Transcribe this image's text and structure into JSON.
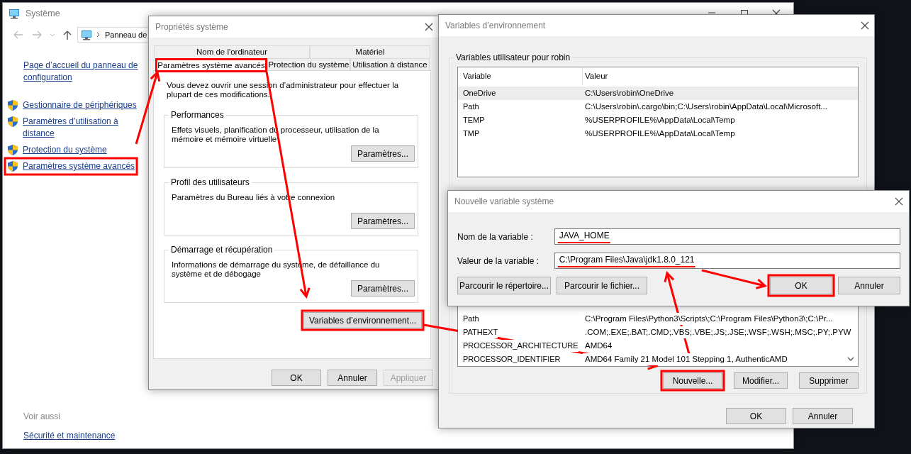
{
  "system_window": {
    "title": "Système",
    "address": "Panneau de",
    "sidebar": {
      "home_link": "Page d’accueil du panneau de configuration",
      "items": [
        {
          "label": "Gestionnaire de périphériques",
          "highlighted": false
        },
        {
          "label": "Paramètres d’utilisation à distance",
          "highlighted": false
        },
        {
          "label": "Protection du système",
          "highlighted": false
        },
        {
          "label": "Paramètres système avancés",
          "highlighted": true
        }
      ]
    },
    "see_also": {
      "heading": "Voir aussi",
      "links": [
        "Sécurité et maintenance"
      ]
    }
  },
  "system_properties": {
    "title": "Propriétés système",
    "tab_rows": [
      [
        {
          "label": "Nom de l'ordinateur",
          "selected": false
        },
        {
          "label": "Matériel",
          "selected": false
        }
      ],
      [
        {
          "label": "Paramètres système avancés",
          "selected": true,
          "highlighted": true
        },
        {
          "label": "Protection du système",
          "selected": false,
          "highlighted": false
        },
        {
          "label": "Utilisation à distance",
          "selected": false,
          "highlighted": false
        }
      ]
    ],
    "notice": "Vous devez ouvrir une session d’administrateur pour effectuer la plupart de ces modifications.",
    "groups": [
      {
        "title": "Performances",
        "description": "Effets visuels, planification du processeur, utilisation de la mémoire et mémoire virtuelle",
        "button": "Paramètres..."
      },
      {
        "title": "Profil des utilisateurs",
        "description": "Paramètres du Bureau liés à votre connexion",
        "button": "Paramètres..."
      },
      {
        "title": "Démarrage et récupération",
        "description": "Informations de démarrage du système, de défaillance du système et de débogage",
        "button": "Paramètres..."
      }
    ],
    "env_button": {
      "label": "Variables d’environnement...",
      "highlighted": true
    },
    "buttons": [
      {
        "label": "OK",
        "disabled": false
      },
      {
        "label": "Annuler",
        "disabled": false
      },
      {
        "label": "Appliquer",
        "disabled": true
      }
    ]
  },
  "environment_variables": {
    "title": "Variables d’environnement",
    "user_group": {
      "title": "Variables utilisateur pour robin",
      "columns": [
        "Variable",
        "Valeur"
      ],
      "rows": [
        {
          "variable": "OneDrive",
          "value": "C:\\Users\\robin\\OneDrive",
          "selected": true
        },
        {
          "variable": "Path",
          "value": "C:\\Users\\robin\\.cargo\\bin;C:\\Users\\robin\\AppData\\Local\\Microsoft...",
          "selected": false
        },
        {
          "variable": "TEMP",
          "value": "%USERPROFILE%\\AppData\\Local\\Temp",
          "selected": false
        },
        {
          "variable": "TMP",
          "value": "%USERPROFILE%\\AppData\\Local\\Temp",
          "selected": false
        }
      ]
    },
    "system_rows": [
      {
        "variable": "Path",
        "value": "C:\\Program Files\\Python3\\Scripts\\;C:\\Program Files\\Python3\\;C:\\Pr...",
        "selected": false
      },
      {
        "variable": "PATHEXT",
        "value": ".COM;.EXE;.BAT;.CMD;.VBS;.VBE;.JS;.JSE;.WSF;.WSH;.MSC;.PY;.PYW",
        "selected": false
      },
      {
        "variable": "PROCESSOR_ARCHITECTURE",
        "value": "AMD64",
        "selected": false
      },
      {
        "variable": "PROCESSOR_IDENTIFIER",
        "value": "AMD64 Family 21 Model 101 Stepping 1, AuthenticAMD",
        "selected": false
      }
    ],
    "system_buttons": [
      {
        "label": "Nouvelle...",
        "highlighted": true
      },
      {
        "label": "Modifier...",
        "highlighted": false
      },
      {
        "label": "Supprimer",
        "highlighted": false
      }
    ],
    "buttons": [
      "OK",
      "Annuler"
    ]
  },
  "new_variable_dialog": {
    "title": "Nouvelle variable système",
    "fields": [
      {
        "label": "Nom de la variable :",
        "value": "JAVA_HOME",
        "underlined": true
      },
      {
        "label": "Valeur de la variable :",
        "value": "C:\\Program Files\\Java\\jdk1.8.0_121",
        "underlined": true
      }
    ],
    "browse_buttons": [
      "Parcourir le répertoire...",
      "Parcourir le fichier..."
    ],
    "buttons": [
      {
        "label": "OK",
        "highlighted": true
      },
      {
        "label": "Annuler",
        "highlighted": false
      }
    ]
  }
}
